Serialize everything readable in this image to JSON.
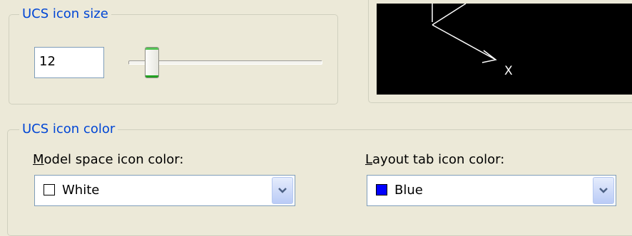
{
  "size_group": {
    "title": "UCS icon size",
    "value": "12",
    "slider_fraction": 0.12
  },
  "preview": {
    "axis_label": "X",
    "background": "#000000",
    "axis_color": "#FFFFFF"
  },
  "color_group": {
    "title": "UCS icon color",
    "model_space": {
      "accel": "M",
      "label_rest": "odel space icon color:",
      "value": "White",
      "swatch_color": "#FFFFFF",
      "button_icon": "chevron-down-icon"
    },
    "layout_tab": {
      "accel": "L",
      "label_rest": "ayout tab icon color:",
      "value": "Blue",
      "swatch_color": "#0000FF",
      "button_icon": "chevron-down-icon"
    }
  },
  "theme": {
    "legend_color": "#0046D5",
    "dialog_background": "#ECE9D8"
  }
}
